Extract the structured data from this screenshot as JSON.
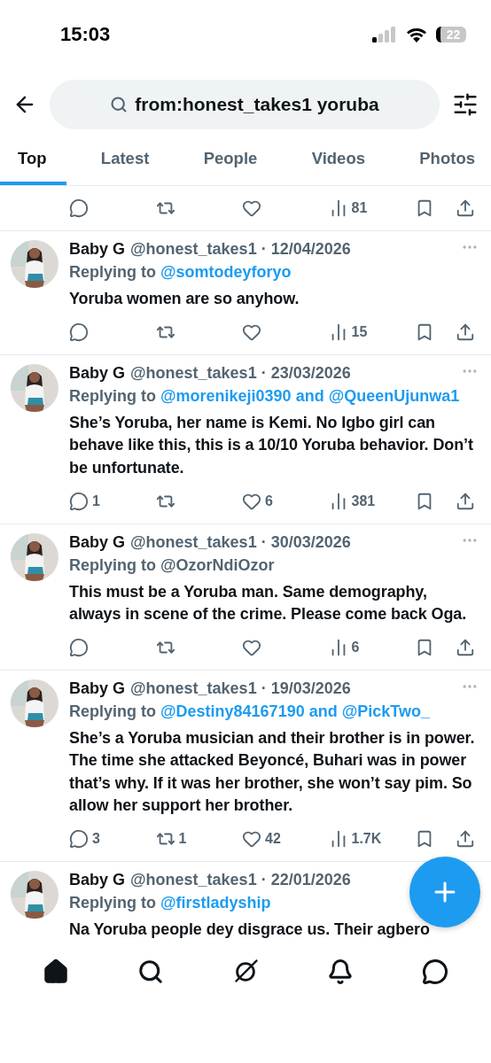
{
  "status_bar": {
    "time": "15:03",
    "battery": "22"
  },
  "search": {
    "value": "from:honest_takes1 yoruba"
  },
  "tabs": [
    {
      "label": "Top",
      "selected": true
    },
    {
      "label": "Latest",
      "selected": false
    },
    {
      "label": "People",
      "selected": false
    },
    {
      "label": "Videos",
      "selected": false
    },
    {
      "label": "Photos",
      "selected": false
    }
  ],
  "tweets": [
    {
      "kind": "actions_only",
      "actions": {
        "views": "81"
      }
    },
    {
      "kind": "full",
      "name": "Baby G",
      "handle": "@honest_takes1",
      "separator": "·",
      "date": "12/04/2026",
      "reply": {
        "prefix": "Replying to",
        "target": "@somtodeyforyo",
        "linked": true
      },
      "text": "Yoruba women are so anyhow.",
      "actions": {
        "views": "15"
      }
    },
    {
      "kind": "full",
      "name": "Baby G",
      "handle": "@honest_takes1",
      "separator": "·",
      "date": "23/03/2026",
      "reply": {
        "prefix": "Replying to",
        "target": "@morenikeji0390 and @QueenUjunwa1",
        "linked": true
      },
      "text": "She’s Yoruba, her name is Kemi. No Igbo girl can behave like this, this is a 10/10 Yoruba behavior. Don’t be unfortunate.",
      "actions": {
        "replies": "1",
        "likes": "6",
        "views": "381"
      }
    },
    {
      "kind": "full",
      "name": "Baby G",
      "handle": "@honest_takes1",
      "separator": "·",
      "date": "30/03/2026",
      "reply": {
        "prefix": "Replying to",
        "target": "@OzorNdiOzor",
        "linked": false
      },
      "text": "This must be a Yoruba man. Same demography, always in scene of the crime. Please come back Oga.",
      "actions": {
        "views": "6"
      }
    },
    {
      "kind": "full",
      "name": "Baby G",
      "handle": "@honest_takes1",
      "separator": "·",
      "date": "19/03/2026",
      "reply": {
        "prefix": "Replying to",
        "target": "@Destiny84167190 and @PickTwo_",
        "linked": true
      },
      "text": "She’s a Yoruba musician and their brother is in power. The time she attacked Beyoncé, Buhari was in power that’s why. If it was her brother, she won’t say pim. So allow her support her brother.",
      "actions": {
        "replies": "3",
        "reposts": "1",
        "likes": "42",
        "views": "1.7K"
      }
    },
    {
      "kind": "partial",
      "name": "Baby G",
      "handle": "@honest_takes1",
      "separator": "·",
      "date": "22/01/2026",
      "reply": {
        "prefix": "Replying to",
        "target": "@firstladyship",
        "linked": true
      },
      "text": "Na Yoruba people dey disgrace us. Their agbero"
    }
  ],
  "nav": [
    {
      "kind": "home",
      "selected": true
    },
    {
      "kind": "search",
      "selected": false
    },
    {
      "kind": "grok",
      "selected": false
    },
    {
      "kind": "bell",
      "selected": false
    },
    {
      "kind": "chat",
      "selected": false
    }
  ]
}
